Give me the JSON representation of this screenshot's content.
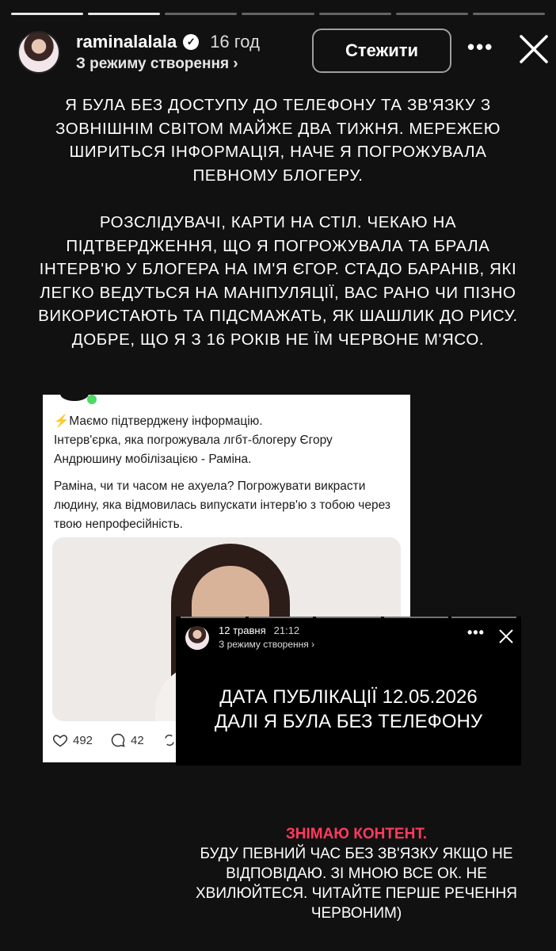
{
  "story": {
    "segments_total": 7,
    "segments_done": 2,
    "username": "raminalalala",
    "time": "16 год",
    "mode": "З режиму створення ›",
    "follow_label": "Стежити",
    "more_icon": "more-icon",
    "close_icon": "close-icon"
  },
  "main_text": {
    "p1": "Я була без доступу до телефону та зв'язку з зовнішнім світом майже два тижня. Мережею шириться інформація, наче я погрожувала певному блогеру.",
    "p2": "Розслідувачі, карти на стіл. Чекаю на підтвердження, що я погрожувала та брала інтерв'ю у блогера на ім'я Єгор. Стадо баранів, які легко ведуться на маніпуляції, вас рано чи пізно використають та підсмажать, як шашлик до рису. Добре, що я з 16 років не їм червоне м'ясо."
  },
  "post": {
    "line1": "⚡Маємо підтверджену інформацію.",
    "line2": "Інтерв'єрка, яка погрожувала лгбт-блогеру Єгору Андрюшину мобілізацією - Раміна.",
    "para2": "Раміна, чи ти часом не ахуела? Погрожувати викрасти людину, яка відмовилась випускати інтерв'ю з тобою через твою непрофесійність.",
    "likes": "492",
    "comments": "42"
  },
  "repost": {
    "date": "12 травня",
    "time": "21:12",
    "mode": "З режиму створення ›",
    "line1": "Дата публікації 12.05.2026",
    "line2": "Далі я була без телефону"
  },
  "footer": {
    "red": "Знімаю контент.",
    "text": "Буду певний час без зв'язку якщо не відповідаю. Зі мною все ок. Не хвилюйтеся. Читайте перше речення червоним)"
  },
  "colors": {
    "background": "#111111",
    "accent_red": "#ff3b5c",
    "online": "#4cd964"
  }
}
